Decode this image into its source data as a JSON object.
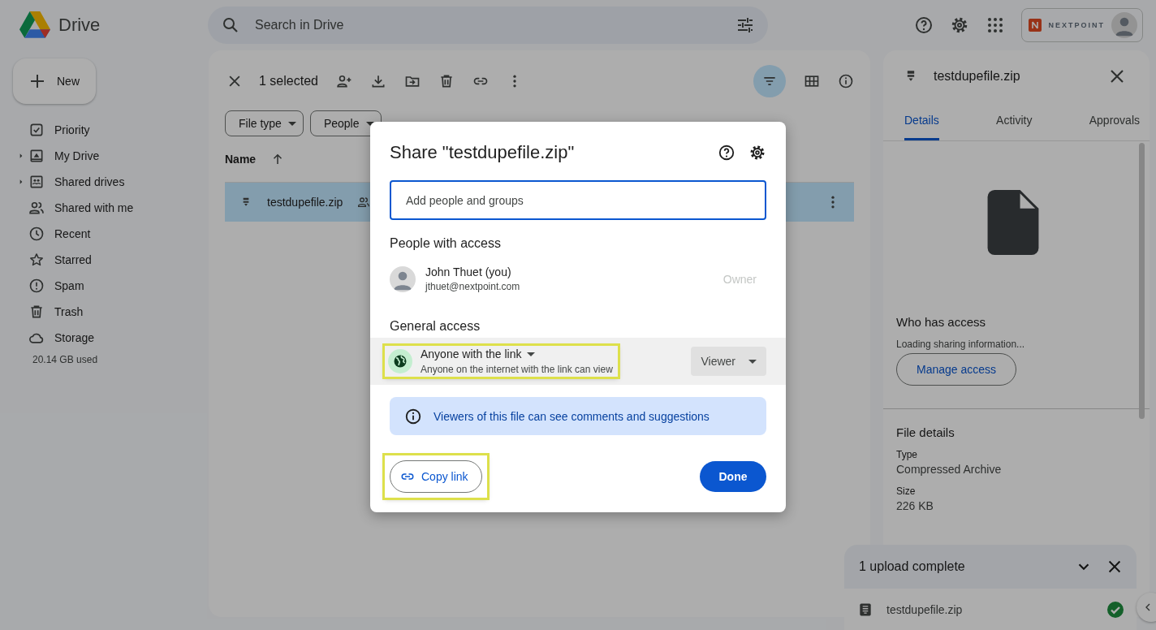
{
  "header": {
    "app_name": "Drive",
    "search": {
      "placeholder": "Search in Drive"
    },
    "account_brand": "NEXTPOINT"
  },
  "sidebar": {
    "new_button": "New",
    "items": [
      {
        "label": "Priority",
        "expandable": false,
        "selected": false
      },
      {
        "label": "My Drive",
        "expandable": true,
        "selected": false
      },
      {
        "label": "Shared drives",
        "expandable": true,
        "selected": false
      },
      {
        "label": "Shared with me",
        "expandable": false,
        "selected": false
      },
      {
        "label": "Recent",
        "expandable": false,
        "selected": false
      },
      {
        "label": "Starred",
        "expandable": false,
        "selected": false
      },
      {
        "label": "Spam",
        "expandable": false,
        "selected": false
      },
      {
        "label": "Trash",
        "expandable": false,
        "selected": false
      },
      {
        "label": "Storage",
        "expandable": false,
        "selected": false
      }
    ],
    "storage_used": "20.14 GB used"
  },
  "toolbar": {
    "selection_count": "1 selected",
    "filter_view_on": true
  },
  "filters": [
    {
      "label": "File type"
    },
    {
      "label": "People"
    }
  ],
  "file_list": {
    "columns": [
      {
        "label": "Name",
        "sort_ascending": true
      }
    ],
    "rows": [
      {
        "name": "testdupefile.zip",
        "shared": true,
        "selected": true
      }
    ]
  },
  "details_panel": {
    "title": "testdupefile.zip",
    "tabs": [
      {
        "label": "Details",
        "selected": true
      },
      {
        "label": "Activity",
        "selected": false
      },
      {
        "label": "Approvals",
        "selected": false
      }
    ],
    "who_has_access": "Who has access",
    "loading_text": "Loading sharing information...",
    "manage_button": "Manage access",
    "file_details_heading": "File details",
    "fields": [
      {
        "label": "Type",
        "value": "Compressed Archive"
      },
      {
        "label": "Size",
        "value": "226 KB"
      }
    ]
  },
  "upload_toast": {
    "title": "1 upload complete",
    "items": [
      {
        "name": "testdupefile.zip",
        "complete": true
      }
    ]
  },
  "share_dialog": {
    "title": "Share \"testdupefile.zip\"",
    "add_placeholder": "Add people and groups",
    "people_heading": "People with access",
    "people": [
      {
        "name": "John Thuet (you)",
        "email": "jthuet@nextpoint.com",
        "role": "Owner",
        "role_disabled": true
      }
    ],
    "general_heading": "General access",
    "general_access": {
      "label": "Anyone with the link",
      "description": "Anyone on the internet with the link can view",
      "role": "Viewer",
      "highlighted": true
    },
    "info": "Viewers of this file can see comments and suggestions",
    "copy_link": {
      "label": "Copy link",
      "highlighted": true
    },
    "done": "Done"
  }
}
